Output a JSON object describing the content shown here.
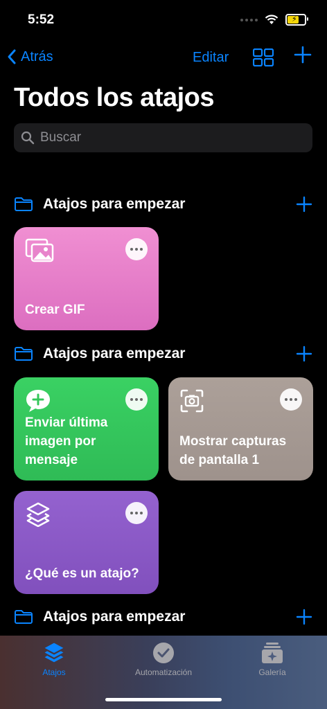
{
  "status": {
    "time": "5:52"
  },
  "nav": {
    "back_label": "Atrás",
    "edit_label": "Editar"
  },
  "page_title": "Todos los atajos",
  "search": {
    "placeholder": "Buscar"
  },
  "sections": [
    {
      "label": "Atajos para empezar",
      "cards": [
        {
          "name": "Crear GIF",
          "icon": "photos-icon",
          "color": "#e27cc7"
        }
      ]
    },
    {
      "label": "Atajos para empezar",
      "cards": [
        {
          "name": "Enviar última imagen por mensaje",
          "icon": "message-plus-icon",
          "color": "#34c759"
        },
        {
          "name": "Mostrar capturas de pantalla 1",
          "icon": "screenshot-icon",
          "color": "#a69a93"
        },
        {
          "name": "¿Qué es un atajo?",
          "icon": "shortcuts-layers-icon",
          "color": "#8a58c6"
        }
      ]
    },
    {
      "label": "Atajos para empezar",
      "cards": []
    }
  ],
  "tabbar": {
    "items": [
      {
        "label": "Atajos",
        "icon": "shortcuts-layers-icon",
        "active": true
      },
      {
        "label": "Automatización",
        "icon": "clock-check-icon",
        "active": false
      },
      {
        "label": "Galería",
        "icon": "gallery-icon",
        "active": false
      }
    ]
  },
  "colors": {
    "accent": "#0a84ff",
    "background": "#000000",
    "search_bg": "#1c1c1e"
  }
}
